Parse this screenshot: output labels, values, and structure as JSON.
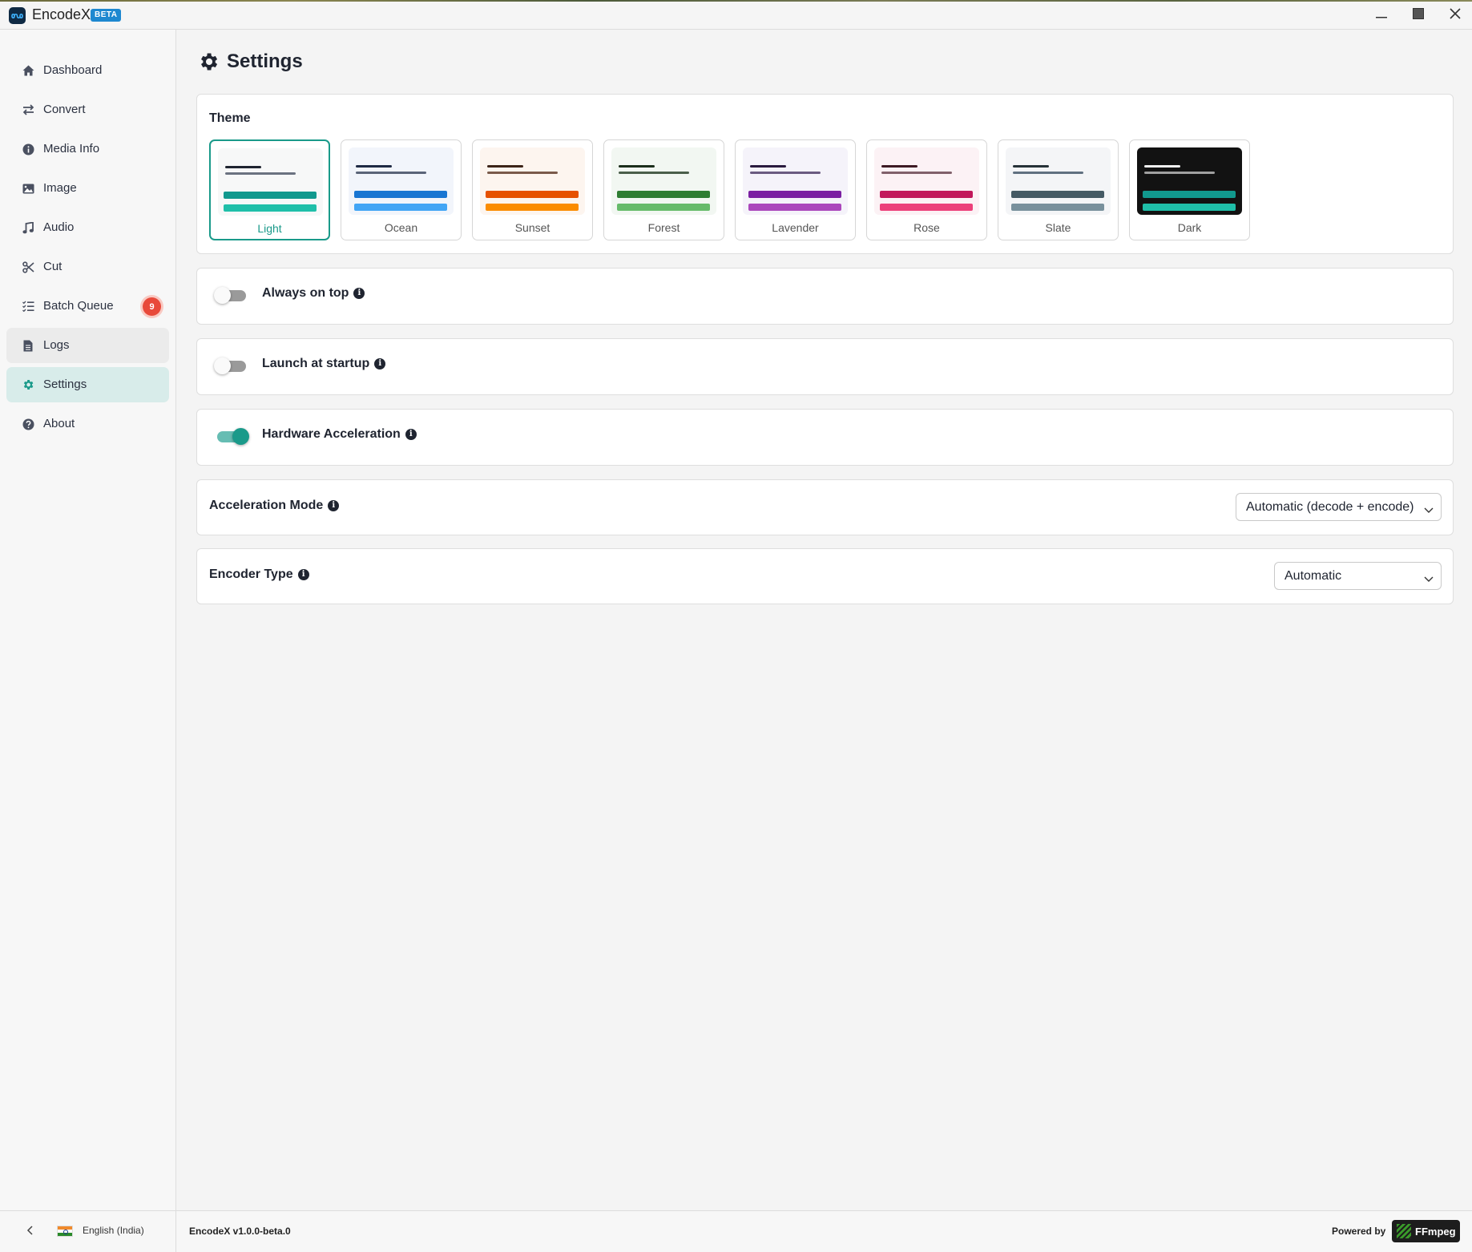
{
  "app": {
    "title": "EncodeX",
    "badge": "BETA",
    "window_controls": [
      "minimize-icon",
      "maximize-icon",
      "close-icon"
    ]
  },
  "sidebar": {
    "items": [
      {
        "label": "Dashboard",
        "icon": "home-icon"
      },
      {
        "label": "Convert",
        "icon": "swap-arrows-icon"
      },
      {
        "label": "Media Info",
        "icon": "info-circle-icon"
      },
      {
        "label": "Image",
        "icon": "image-icon"
      },
      {
        "label": "Audio",
        "icon": "music-note-icon"
      },
      {
        "label": "Cut",
        "icon": "scissors-icon"
      },
      {
        "label": "Batch Queue",
        "icon": "list-check-icon",
        "badge": "9"
      },
      {
        "label": "Logs",
        "icon": "file-text-icon",
        "state": "hover"
      },
      {
        "label": "Settings",
        "icon": "gear-icon",
        "state": "active"
      },
      {
        "label": "About",
        "icon": "question-circle-icon"
      }
    ]
  },
  "page": {
    "title": "Settings",
    "title_icon": "gear-icon"
  },
  "theme": {
    "label": "Theme",
    "selected": "Light",
    "options": [
      {
        "name": "Light",
        "bg": "#f7f8f8",
        "line1": "#1f2430",
        "line2": "#6b7280",
        "bar1": "#11998e",
        "bar2": "#1fbfa9"
      },
      {
        "name": "Ocean",
        "bg": "#f2f5fb",
        "line1": "#1f2a44",
        "line2": "#5a6478",
        "bar1": "#1976d2",
        "bar2": "#42a5f5"
      },
      {
        "name": "Sunset",
        "bg": "#fdf5ef",
        "line1": "#3d2418",
        "line2": "#7a5a4a",
        "bar1": "#e65100",
        "bar2": "#fb8c00"
      },
      {
        "name": "Forest",
        "bg": "#f2f7f2",
        "line1": "#1b2e1b",
        "line2": "#4a5e4a",
        "bar1": "#2e7d32",
        "bar2": "#66bb6a"
      },
      {
        "name": "Lavender",
        "bg": "#f5f3fa",
        "line1": "#2a1a3e",
        "line2": "#6a5a80",
        "bar1": "#7b1fa2",
        "bar2": "#ab47bc"
      },
      {
        "name": "Rose",
        "bg": "#fcf2f5",
        "line1": "#3e1a24",
        "line2": "#80606a",
        "bar1": "#c2185b",
        "bar2": "#ec407a"
      },
      {
        "name": "Slate",
        "bg": "#f4f5f7",
        "line1": "#263238",
        "line2": "#607080",
        "bar1": "#455a64",
        "bar2": "#78909c"
      },
      {
        "name": "Dark",
        "bg": "#121212",
        "line1": "#f0f0f0",
        "line2": "#a0a0a0",
        "bar1": "#11998e",
        "bar2": "#1fbfa9"
      }
    ]
  },
  "settings": {
    "always_on_top": {
      "label": "Always on top",
      "enabled": false
    },
    "launch_at_startup": {
      "label": "Launch at startup",
      "enabled": false
    },
    "hardware_acceleration": {
      "label": "Hardware Acceleration",
      "enabled": true
    },
    "acceleration_mode": {
      "label": "Acceleration Mode",
      "value": "Automatic (decode + encode)"
    },
    "encoder_type": {
      "label": "Encoder Type",
      "value": "Automatic"
    }
  },
  "footer": {
    "language": "English (India)",
    "flag": "india-flag-icon",
    "version": "EncodeX v1.0.0-beta.0",
    "powered_by": "Powered by",
    "ffmpeg": "FFmpeg"
  },
  "colors": {
    "accent": "#1a9a8a",
    "active_nav_bg": "#d8ecea",
    "badge": "#e8493a",
    "beta_badge": "#1e88d0"
  }
}
